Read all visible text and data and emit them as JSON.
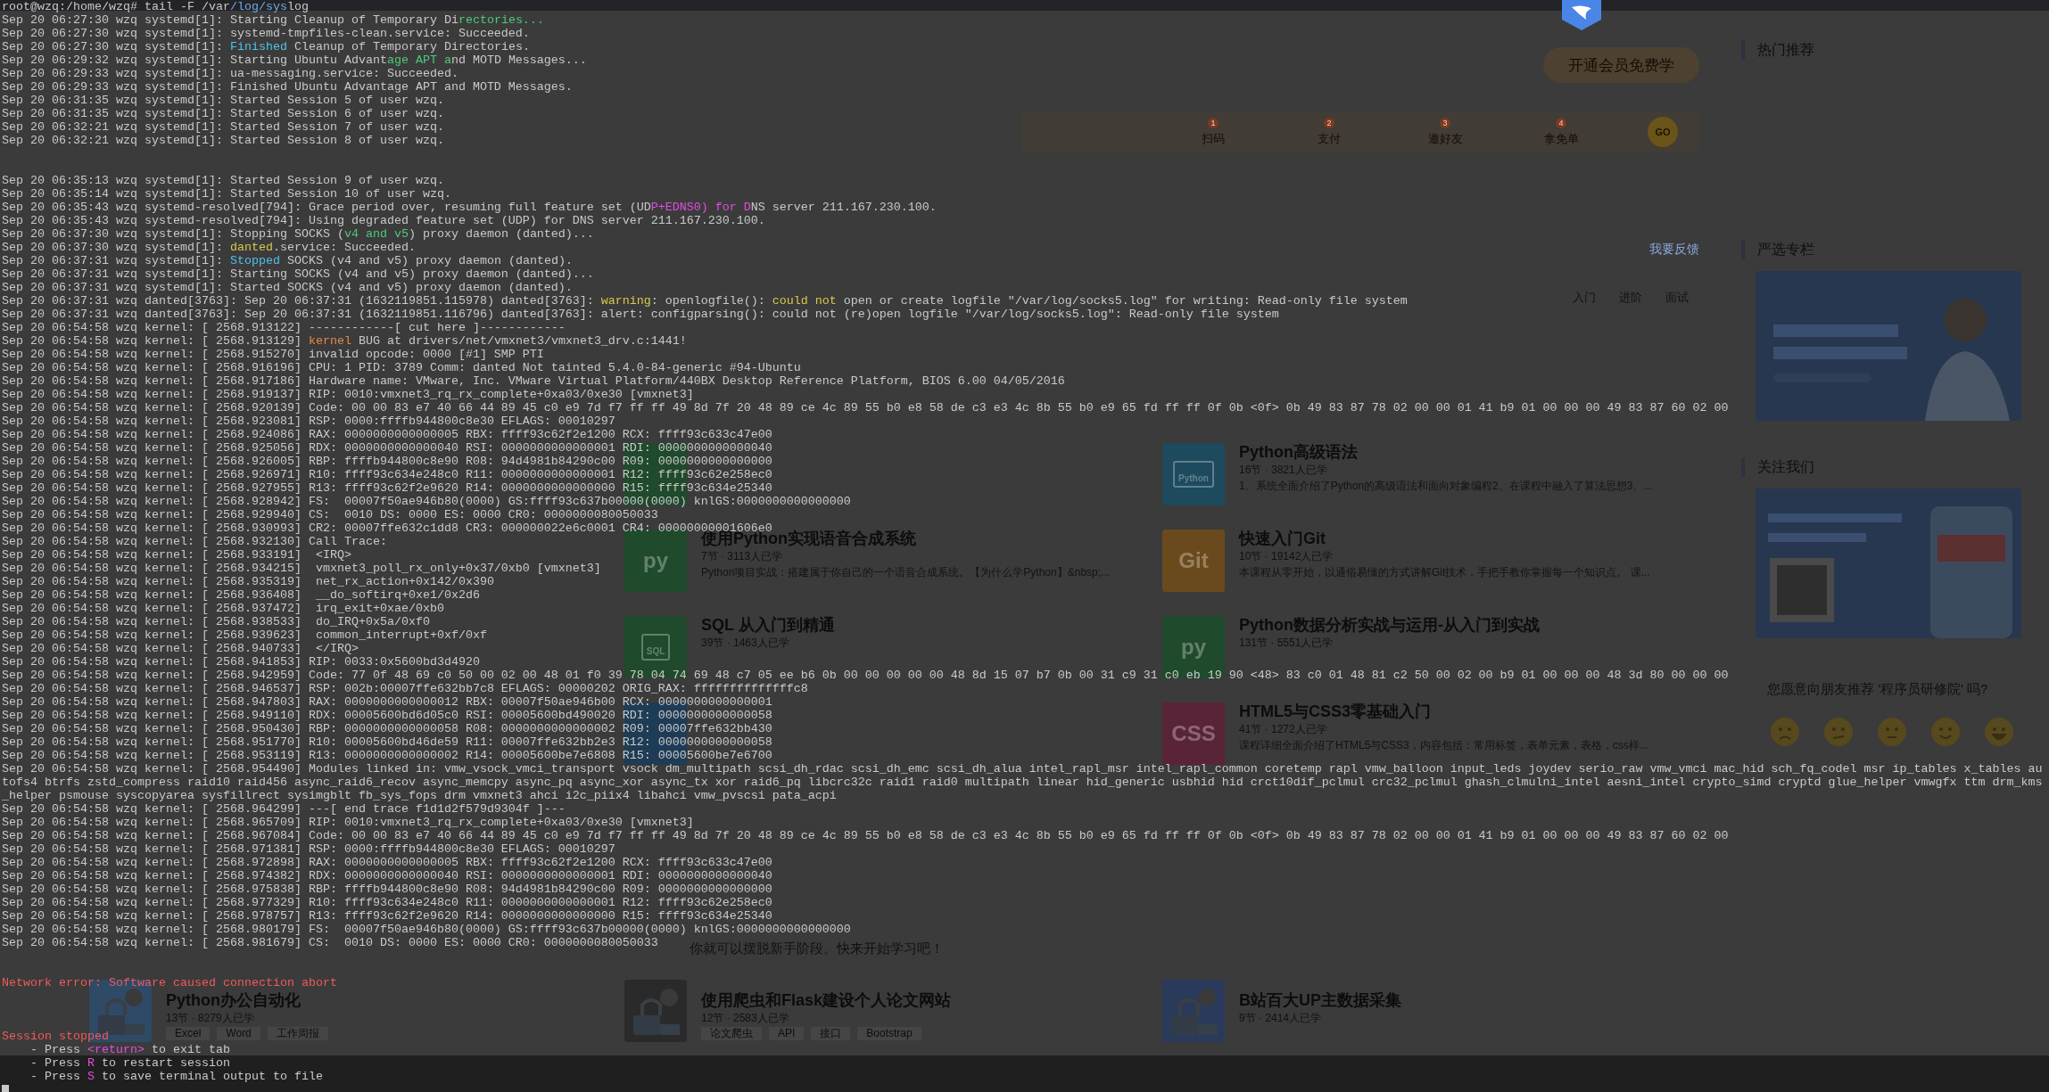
{
  "terminal": {
    "lines": [
      {
        "kind": "prompt",
        "parts": [
          {
            "text": "root@wzq:/home/wzq# tail -F /var"
          },
          {
            "text": "/log/sys",
            "color": "#6fa8e8"
          },
          {
            "text": "log"
          }
        ]
      },
      {
        "kind": "colored",
        "parts": [
          {
            "text": "Sep 20 06:27:30 wzq systemd[1]: Starting Cleanup of Temporary Di"
          },
          {
            "text": "rectories...",
            "color": "#4ec97a"
          }
        ]
      },
      {
        "kind": "text",
        "text": "Sep 20 06:27:30 wzq systemd[1]: systemd-tmpfiles-clean.service: Succeeded."
      },
      {
        "kind": "colored",
        "parts": [
          {
            "text": "Sep 20 06:27:30 wzq systemd[1]: "
          },
          {
            "text": "Finished",
            "color": "#4fc3e8"
          },
          {
            "text": " Cleanup of Temporary Directories."
          }
        ]
      },
      {
        "kind": "colored",
        "parts": [
          {
            "text": "Sep 20 06:29:32 wzq systemd[1]: Starting Ubuntu Advant"
          },
          {
            "text": "age APT a",
            "color": "#4ec97a"
          },
          {
            "text": "nd MOTD Messages..."
          }
        ]
      },
      {
        "kind": "text",
        "text": "Sep 20 06:29:33 wzq systemd[1]: ua-messaging.service: Succeeded."
      },
      {
        "kind": "text",
        "text": "Sep 20 06:29:33 wzq systemd[1]: Finished Ubuntu Advantage APT and MOTD Messages."
      },
      {
        "kind": "text",
        "text": "Sep 20 06:31:35 wzq systemd[1]: Started Session 5 of user wzq."
      },
      {
        "kind": "text",
        "text": "Sep 20 06:31:35 wzq systemd[1]: Started Session 6 of user wzq."
      },
      {
        "kind": "text",
        "text": "Sep 20 06:32:21 wzq systemd[1]: Started Session 7 of user wzq."
      },
      {
        "kind": "text",
        "text": "Sep 20 06:32:21 wzq systemd[1]: Started Session 8 of user wzq."
      },
      {
        "kind": "blank"
      },
      {
        "kind": "blank"
      },
      {
        "kind": "text",
        "text": "Sep 20 06:35:13 wzq systemd[1]: Started Session 9 of user wzq."
      },
      {
        "kind": "text",
        "text": "Sep 20 06:35:14 wzq systemd[1]: Started Session 10 of user wzq."
      },
      {
        "kind": "colored",
        "parts": [
          {
            "text": "Sep 20 06:35:43 wzq systemd-resolved[794]: Grace period over, resuming full feature set (UD"
          },
          {
            "text": "P+EDNS0) for D",
            "color": "#e04ee0"
          },
          {
            "text": "NS server 211.167.230.100."
          }
        ]
      },
      {
        "kind": "text",
        "text": "Sep 20 06:35:43 wzq systemd-resolved[794]: Using degraded feature set (UDP) for DNS server 211.167.230.100."
      },
      {
        "kind": "colored",
        "parts": [
          {
            "text": "Sep 20 06:37:30 wzq systemd[1]: Stopping SOCKS ("
          },
          {
            "text": "v4 and v5",
            "color": "#4ec97a"
          },
          {
            "text": ") proxy daemon (danted)..."
          }
        ]
      },
      {
        "kind": "colored",
        "parts": [
          {
            "text": "Sep 20 06:37:30 wzq systemd[1]: "
          },
          {
            "text": "danted",
            "color": "#d9c84a"
          },
          {
            "text": ".service: Succeeded."
          }
        ]
      },
      {
        "kind": "colored",
        "parts": [
          {
            "text": "Sep 20 06:37:31 wzq systemd[1]: "
          },
          {
            "text": "Stopped",
            "color": "#4fc3e8"
          },
          {
            "text": " SOCKS (v4 and v5) proxy daemon (danted)."
          }
        ]
      },
      {
        "kind": "text",
        "text": "Sep 20 06:37:31 wzq systemd[1]: Starting SOCKS (v4 and v5) proxy daemon (danted)..."
      },
      {
        "kind": "text",
        "text": "Sep 20 06:37:31 wzq systemd[1]: Started SOCKS (v4 and v5) proxy daemon (danted)."
      },
      {
        "kind": "colored",
        "parts": [
          {
            "text": "Sep 20 06:37:31 wzq danted[3763]: Sep 20 06:37:31 (1632119851.115978) danted[3763]: "
          },
          {
            "text": "warning",
            "color": "#d9c84a"
          },
          {
            "text": ": openlogfile(): "
          },
          {
            "text": "could not",
            "color": "#d9c84a"
          },
          {
            "text": " open or create logfile \"/var/log/socks5.log\" for writing: Read-only file system"
          }
        ]
      },
      {
        "kind": "text",
        "text": "Sep 20 06:37:31 wzq danted[3763]: Sep 20 06:37:31 (1632119851.116796) danted[3763]: alert: configparsing(): could not (re)open logfile \"/var/log/socks5.log\": Read-only file system"
      },
      {
        "kind": "text",
        "text": "Sep 20 06:54:58 wzq kernel: [ 2568.913122] ------------[ cut here ]------------"
      },
      {
        "kind": "colored",
        "parts": [
          {
            "text": "Sep 20 06:54:58 wzq kernel: [ 2568.913129] "
          },
          {
            "text": "kernel",
            "color": "#e8874a"
          },
          {
            "text": " BUG at drivers/net/vmxnet3/vmxnet3_drv.c:1441!"
          }
        ]
      },
      {
        "kind": "text",
        "text": "Sep 20 06:54:58 wzq kernel: [ 2568.915270] invalid opcode: 0000 [#1] SMP PTI"
      },
      {
        "kind": "text",
        "text": "Sep 20 06:54:58 wzq kernel: [ 2568.916196] CPU: 1 PID: 3789 Comm: danted Not tainted 5.4.0-84-generic #94-Ubuntu"
      },
      {
        "kind": "text",
        "text": "Sep 20 06:54:58 wzq kernel: [ 2568.917186] Hardware name: VMware, Inc. VMware Virtual Platform/440BX Desktop Reference Platform, BIOS 6.00 04/05/2016"
      },
      {
        "kind": "text",
        "text": "Sep 20 06:54:58 wzq kernel: [ 2568.919137] RIP: 0010:vmxnet3_rq_rx_complete+0xa03/0xe30 [vmxnet3]"
      },
      {
        "kind": "text",
        "text": "Sep 20 06:54:58 wzq kernel: [ 2568.920139] Code: 00 00 83 e7 40 66 44 89 45 c0 e9 7d f7 ff ff 49 8d 7f 20 48 89 ce 4c 89 55 b0 e8 58 de c3 e3 4c 8b 55 b0 e9 65 fd ff ff 0f 0b <0f> 0b 49 83 87 78 02 00 00 01 41 b9 01 00 00 00 49 83 87 60 02 00"
      },
      {
        "kind": "text",
        "text": "Sep 20 06:54:58 wzq kernel: [ 2568.923081] RSP: 0000:ffffb944800c8e30 EFLAGS: 00010297"
      },
      {
        "kind": "text",
        "text": "Sep 20 06:54:58 wzq kernel: [ 2568.924086] RAX: 0000000000000005 RBX: ffff93c62f2e1200 RCX: ffff93c633c47e00"
      },
      {
        "kind": "text",
        "text": "Sep 20 06:54:58 wzq kernel: [ 2568.925056] RDX: 0000000000000040 RSI: 0000000000000001 RDI: 0000000000000040"
      },
      {
        "kind": "text",
        "text": "Sep 20 06:54:58 wzq kernel: [ 2568.926005] RBP: ffffb944800c8e90 R08: 94d4981b84290c00 R09: 0000000000000000"
      },
      {
        "kind": "text",
        "text": "Sep 20 06:54:58 wzq kernel: [ 2568.926971] R10: ffff93c634e248c0 R11: 0000000000000001 R12: ffff93c62e258ec0"
      },
      {
        "kind": "text",
        "text": "Sep 20 06:54:58 wzq kernel: [ 2568.927955] R13: ffff93c62f2e9620 R14: 0000000000000000 R15: ffff93c634e25340"
      },
      {
        "kind": "text",
        "text": "Sep 20 06:54:58 wzq kernel: [ 2568.928942] FS:  00007f50ae946b80(0000) GS:ffff93c637b00000(0000) knlGS:0000000000000000"
      },
      {
        "kind": "text",
        "text": "Sep 20 06:54:58 wzq kernel: [ 2568.929940] CS:  0010 DS: 0000 ES: 0000 CR0: 0000000080050033"
      },
      {
        "kind": "text",
        "text": "Sep 20 06:54:58 wzq kernel: [ 2568.930993] CR2: 00007ffe632c1dd8 CR3: 000000022e6c0001 CR4: 00000000001606e0"
      },
      {
        "kind": "text",
        "text": "Sep 20 06:54:58 wzq kernel: [ 2568.932130] Call Trace:"
      },
      {
        "kind": "text",
        "text": "Sep 20 06:54:58 wzq kernel: [ 2568.933191]  <IRQ>"
      },
      {
        "kind": "text",
        "text": "Sep 20 06:54:58 wzq kernel: [ 2568.934215]  vmxnet3_poll_rx_only+0x37/0xb0 [vmxnet3]"
      },
      {
        "kind": "text",
        "text": "Sep 20 06:54:58 wzq kernel: [ 2568.935319]  net_rx_action+0x142/0x390"
      },
      {
        "kind": "text",
        "text": "Sep 20 06:54:58 wzq kernel: [ 2568.936408]  __do_softirq+0xe1/0x2d6"
      },
      {
        "kind": "text",
        "text": "Sep 20 06:54:58 wzq kernel: [ 2568.937472]  irq_exit+0xae/0xb0"
      },
      {
        "kind": "text",
        "text": "Sep 20 06:54:58 wzq kernel: [ 2568.938533]  do_IRQ+0x5a/0xf0"
      },
      {
        "kind": "text",
        "text": "Sep 20 06:54:58 wzq kernel: [ 2568.939623]  common_interrupt+0xf/0xf"
      },
      {
        "kind": "text",
        "text": "Sep 20 06:54:58 wzq kernel: [ 2568.940733]  </IRQ>"
      },
      {
        "kind": "text",
        "text": "Sep 20 06:54:58 wzq kernel: [ 2568.941853] RIP: 0033:0x5600bd3d4920"
      },
      {
        "kind": "text",
        "text": "Sep 20 06:54:58 wzq kernel: [ 2568.942959] Code: 77 0f 48 69 c0 50 00 02 00 48 01 f0 39 78 04 74 69 48 c7 05 ee b6 0b 00 00 00 00 00 48 8d 15 07 b7 0b 00 31 c9 31 c0 eb 19 90 <48> 83 c0 01 48 81 c2 50 00 02 00 b9 01 00 00 00 48 3d 80 00 00 00"
      },
      {
        "kind": "text",
        "text": "Sep 20 06:54:58 wzq kernel: [ 2568.946537] RSP: 002b:00007ffe632bb7c8 EFLAGS: 00000202 ORIG_RAX: ffffffffffffffc8"
      },
      {
        "kind": "text",
        "text": "Sep 20 06:54:58 wzq kernel: [ 2568.947803] RAX: 0000000000000012 RBX: 00007f50ae946b00 RCX: 0000000000000001"
      },
      {
        "kind": "text",
        "text": "Sep 20 06:54:58 wzq kernel: [ 2568.949110] RDX: 00005600bd6d05c0 RSI: 00005600bd490020 RDI: 0000000000000058"
      },
      {
        "kind": "text",
        "text": "Sep 20 06:54:58 wzq kernel: [ 2568.950430] RBP: 0000000000000058 R08: 0000000000000002 R09: 00007ffe632bb430"
      },
      {
        "kind": "text",
        "text": "Sep 20 06:54:58 wzq kernel: [ 2568.951770] R10: 00005600bd46de59 R11: 00007ffe632bb2e3 R12: 0000000000000058"
      },
      {
        "kind": "text",
        "text": "Sep 20 06:54:58 wzq kernel: [ 2568.953119] R13: 0000000000000002 R14: 00005600be7e6808 R15: 00005600be7e6700"
      },
      {
        "kind": "text",
        "text": "Sep 20 06:54:58 wzq kernel: [ 2568.954490] Modules linked in: vmw_vsock_vmci_transport vsock dm_multipath scsi_dh_rdac scsi_dh_emc scsi_dh_alua intel_rapl_msr intel_rapl_common coretemp rapl vmw_balloon input_leds joydev serio_raw vmw_vmci mac_hid sch_fq_codel msr ip_tables x_tables au"
      },
      {
        "kind": "text",
        "text": "tofs4 btrfs zstd_compress raid10 raid456 async_raid6_recov async_memcpy async_pq async_xor async_tx xor raid6_pq libcrc32c raid1 raid0 multipath linear hid_generic usbhid hid crct10dif_pclmul crc32_pclmul ghash_clmulni_intel aesni_intel crypto_simd cryptd glue_helper vmwgfx ttm drm_kms"
      },
      {
        "kind": "text",
        "text": "_helper psmouse syscopyarea sysfillrect sysimgblt fb_sys_fops drm vmxnet3 ahci i2c_piix4 libahci vmw_pvscsi pata_acpi"
      },
      {
        "kind": "text",
        "text": "Sep 20 06:54:58 wzq kernel: [ 2568.964299] ---[ end trace f1d1d2f579d9304f ]---"
      },
      {
        "kind": "text",
        "text": "Sep 20 06:54:58 wzq kernel: [ 2568.965709] RIP: 0010:vmxnet3_rq_rx_complete+0xa03/0xe30 [vmxnet3]"
      },
      {
        "kind": "text",
        "text": "Sep 20 06:54:58 wzq kernel: [ 2568.967084] Code: 00 00 83 e7 40 66 44 89 45 c0 e9 7d f7 ff ff 49 8d 7f 20 48 89 ce 4c 89 55 b0 e8 58 de c3 e3 4c 8b 55 b0 e9 65 fd ff ff 0f 0b <0f> 0b 49 83 87 78 02 00 00 01 41 b9 01 00 00 00 49 83 87 60 02 00"
      },
      {
        "kind": "text",
        "text": "Sep 20 06:54:58 wzq kernel: [ 2568.971381] RSP: 0000:ffffb944800c8e30 EFLAGS: 00010297"
      },
      {
        "kind": "text",
        "text": "Sep 20 06:54:58 wzq kernel: [ 2568.972898] RAX: 0000000000000005 RBX: ffff93c62f2e1200 RCX: ffff93c633c47e00"
      },
      {
        "kind": "text",
        "text": "Sep 20 06:54:58 wzq kernel: [ 2568.974382] RDX: 0000000000000040 RSI: 0000000000000001 RDI: 0000000000000040"
      },
      {
        "kind": "text",
        "text": "Sep 20 06:54:58 wzq kernel: [ 2568.975838] RBP: ffffb944800c8e90 R08: 94d4981b84290c00 R09: 0000000000000000"
      },
      {
        "kind": "text",
        "text": "Sep 20 06:54:58 wzq kernel: [ 2568.977329] R10: ffff93c634e248c0 R11: 0000000000000001 R12: ffff93c62e258ec0"
      },
      {
        "kind": "text",
        "text": "Sep 20 06:54:58 wzq kernel: [ 2568.978757] R13: ffff93c62f2e9620 R14: 0000000000000000 R15: ffff93c634e25340"
      },
      {
        "kind": "text",
        "text": "Sep 20 06:54:58 wzq kernel: [ 2568.980179] FS:  00007f50ae946b80(0000) GS:ffff93c637b00000(0000) knlGS:0000000000000000"
      },
      {
        "kind": "text",
        "text": "Sep 20 06:54:58 wzq kernel: [ 2568.981679] CS:  0010 DS: 0000 ES: 0000 CR0: 0000000080050033"
      },
      {
        "kind": "blank"
      },
      {
        "kind": "blank"
      },
      {
        "kind": "colored",
        "parts": [
          {
            "text": "Network error: Software caused connection abort",
            "color": "#f05a5a"
          }
        ]
      },
      {
        "kind": "blank"
      },
      {
        "kind": "blank"
      },
      {
        "kind": "blank"
      },
      {
        "kind": "colored",
        "parts": [
          {
            "text": "Session stopped",
            "color": "#f05a5a"
          }
        ]
      },
      {
        "kind": "colored",
        "parts": [
          {
            "text": "    - Press "
          },
          {
            "text": "<return>",
            "color": "#e04ee0"
          },
          {
            "text": " to exit tab"
          }
        ]
      },
      {
        "kind": "colored",
        "parts": [
          {
            "text": "    - Press "
          },
          {
            "text": "R",
            "color": "#e04ee0"
          },
          {
            "text": " to restart session"
          }
        ]
      },
      {
        "kind": "colored",
        "parts": [
          {
            "text": "    - Press "
          },
          {
            "text": "S",
            "color": "#e04ee0"
          },
          {
            "text": " to save terminal output to file"
          }
        ]
      },
      {
        "kind": "cursor"
      }
    ]
  },
  "page": {
    "hero": {
      "cta": "开通会员免费学",
      "steps": [
        {
          "number": "1",
          "label": "扫码"
        },
        {
          "number": "2",
          "label": "支付"
        },
        {
          "number": "3",
          "label": "邀好友"
        },
        {
          "number": "4",
          "label": "拿免单"
        }
      ],
      "go": "GO",
      "feedback": "我要反馈"
    },
    "level_tabs": [
      {
        "label": "入门",
        "selected": false
      },
      {
        "label": "进阶",
        "selected": false
      },
      {
        "label": "面试",
        "selected": false
      }
    ],
    "courses_upper": {
      "middle": [
        {
          "icon": {
            "kind": "plain",
            "color": "#1f4a2c"
          }
        },
        {
          "icon": {
            "kind": "label",
            "color": "#1f4a2c",
            "text": "py"
          },
          "title": "使用Python实现语音合成系统",
          "meta": "7节 · 3113人已学",
          "desc": "Python项目实战：搭建属于你自己的一个语音合成系统。【为什么学Python】&nbsp;..."
        },
        {
          "icon": {
            "kind": "box",
            "color": "#1f4a2c",
            "text": "SQL"
          },
          "title": "SQL 从入门到精通",
          "meta": "39节 · 1463人已学"
        },
        {
          "icon": {
            "kind": "plain",
            "color": "#1e3c55"
          }
        }
      ],
      "right": [
        {
          "icon": {
            "kind": "window",
            "color": "#1d4a5c",
            "text": "Python"
          },
          "title": "Python高级语法",
          "meta": "16节 · 3821人已学",
          "desc": "1、系统全面介绍了Python的高级语法和面向对象编程2、在课程中融入了算法思想3、..."
        },
        {
          "icon": {
            "kind": "label",
            "color": "#6a4a1c",
            "text": "Git"
          },
          "title": "快速入门Git",
          "meta": "10节 · 19142人已学",
          "desc": "本课程从零开始，以通俗易懂的方式讲解Git技术，手把手教你掌握每一个知识点。 课..."
        },
        {
          "icon": {
            "kind": "label",
            "color": "#1f4a2c",
            "text": "py"
          },
          "title": "Python数据分析实战与运用-从入门到实战",
          "meta": "131节 · 5551人已学"
        },
        {
          "icon": {
            "kind": "label",
            "color": "#5a2438",
            "text": "CSS"
          },
          "title": "HTML5与CSS3零基础入门",
          "meta": "41节 · 1272人已学",
          "desc": "课程详细全面介绍了HTML5与CSS3，内容包括：常用标签，表单元素，表格，css样..."
        }
      ]
    },
    "note": "你就可以摆脱新手阶段。快来开始学习吧！",
    "courses_lower": [
      {
        "icon": {
          "kind": "picture",
          "color": "#2e4a66"
        },
        "title": "Python办公自动化",
        "meta": "13节 · 8279人已学",
        "tags": [
          "Excel",
          "Word",
          "工作周报"
        ]
      },
      {
        "icon": {
          "kind": "picture",
          "color": "#2a2a2a"
        },
        "title": "使用爬虫和Flask建设个人论文网站",
        "meta": "12节 · 2583人已学",
        "tags": [
          "论文爬虫",
          "API",
          "接口",
          "Bootstrap"
        ]
      },
      {
        "icon": {
          "kind": "picture",
          "color": "#2a3a5a"
        },
        "title": "B站百大UP主数据采集",
        "meta": "9节 · 2414人已学"
      }
    ],
    "sidebar": {
      "sections": [
        {
          "title": "热门推荐"
        },
        {
          "title": "严选专栏",
          "banner": {
            "kind": "picture"
          }
        },
        {
          "title": "关注我们",
          "banner": {
            "kind": "picture"
          }
        }
      ],
      "survey": {
        "question": "您愿意向朋友推荐 '程序员研修院' 吗?",
        "faces": [
          {
            "kind": "angry"
          },
          {
            "kind": "confused"
          },
          {
            "kind": "neutral"
          },
          {
            "kind": "smile"
          },
          {
            "kind": "laugh"
          }
        ]
      }
    }
  }
}
